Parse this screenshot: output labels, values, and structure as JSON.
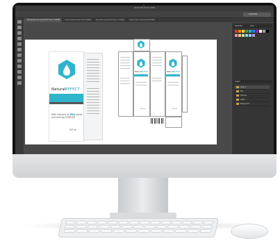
{
  "app": {
    "window_title": "Adobe Photoshop 2020",
    "top_right_label": "Properties"
  },
  "document_tabs": [
    "Mockup_Box_front.psd @ 50% (Layer 1, RGB/8)",
    "Label_Template.psd @ 33.3% (RGB/8)",
    "Box_Dieline.psd @ 25% (Layer 2, RGB/8)",
    "Product_Shot_v2.psd @ 50% (RGB/8)"
  ],
  "panels": {
    "swatches_tab": "Swatches",
    "color_tab": "Color",
    "layers_tab": "Layers",
    "layers": [
      "Layer 1",
      "Box",
      "Shadow",
      "Label",
      "Background"
    ]
  },
  "product": {
    "brand_natural": "Natural",
    "brand_effect": "EFFECT",
    "description_prefix": "With extracts of ",
    "description_highlight": "DNA",
    "description_suffix": " seeds and healing POWDER",
    "volume": "150 ml",
    "dieline_volume": "150 ml"
  },
  "colors": {
    "accent_teal": "#2fb4cb",
    "ui_dark": "#3b3b3b"
  }
}
